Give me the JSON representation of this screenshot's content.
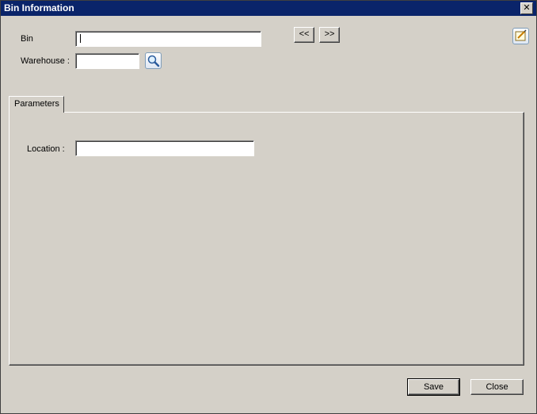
{
  "window": {
    "title": "Bin Information"
  },
  "form": {
    "bin_label": "Bin",
    "bin_value": "",
    "warehouse_label": "Warehouse :",
    "warehouse_value": "",
    "prev_label": "<<",
    "next_label": ">>"
  },
  "tabs": [
    {
      "label": "Parameters",
      "active": true
    }
  ],
  "parameters": {
    "location_label": "Location :",
    "location_value": ""
  },
  "footer": {
    "save_label": "Save",
    "close_label": "Close"
  },
  "icons": {
    "lookup": "magnifier-icon",
    "edit": "edit-note-icon",
    "close": "close-icon"
  }
}
